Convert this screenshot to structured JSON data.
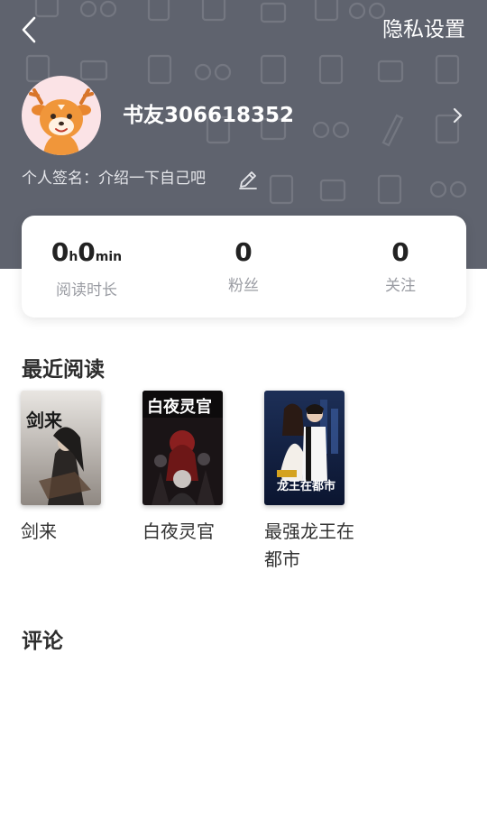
{
  "header": {
    "privacy_label": "隐私设置"
  },
  "profile": {
    "username": "书友306618352",
    "signature": "个人签名：介绍一下自己吧"
  },
  "stats": {
    "reading_hours": "0",
    "reading_hours_unit": "h",
    "reading_minutes": "0",
    "reading_minutes_unit": "min",
    "reading_label": "阅读时长",
    "fans_value": "0",
    "fans_label": "粉丝",
    "following_value": "0",
    "following_label": "关注"
  },
  "recent_reading": {
    "title": "最近阅读",
    "books": [
      {
        "title": "剑来",
        "cover_text": "剑来"
      },
      {
        "title": "白夜灵官",
        "cover_text": "白夜灵官"
      },
      {
        "title": "最强龙王在都市",
        "cover_text": "龙王在都市"
      }
    ]
  },
  "comments": {
    "title": "评论"
  },
  "colors": {
    "header_bg": "#5f636e",
    "card_bg": "#ffffff"
  }
}
